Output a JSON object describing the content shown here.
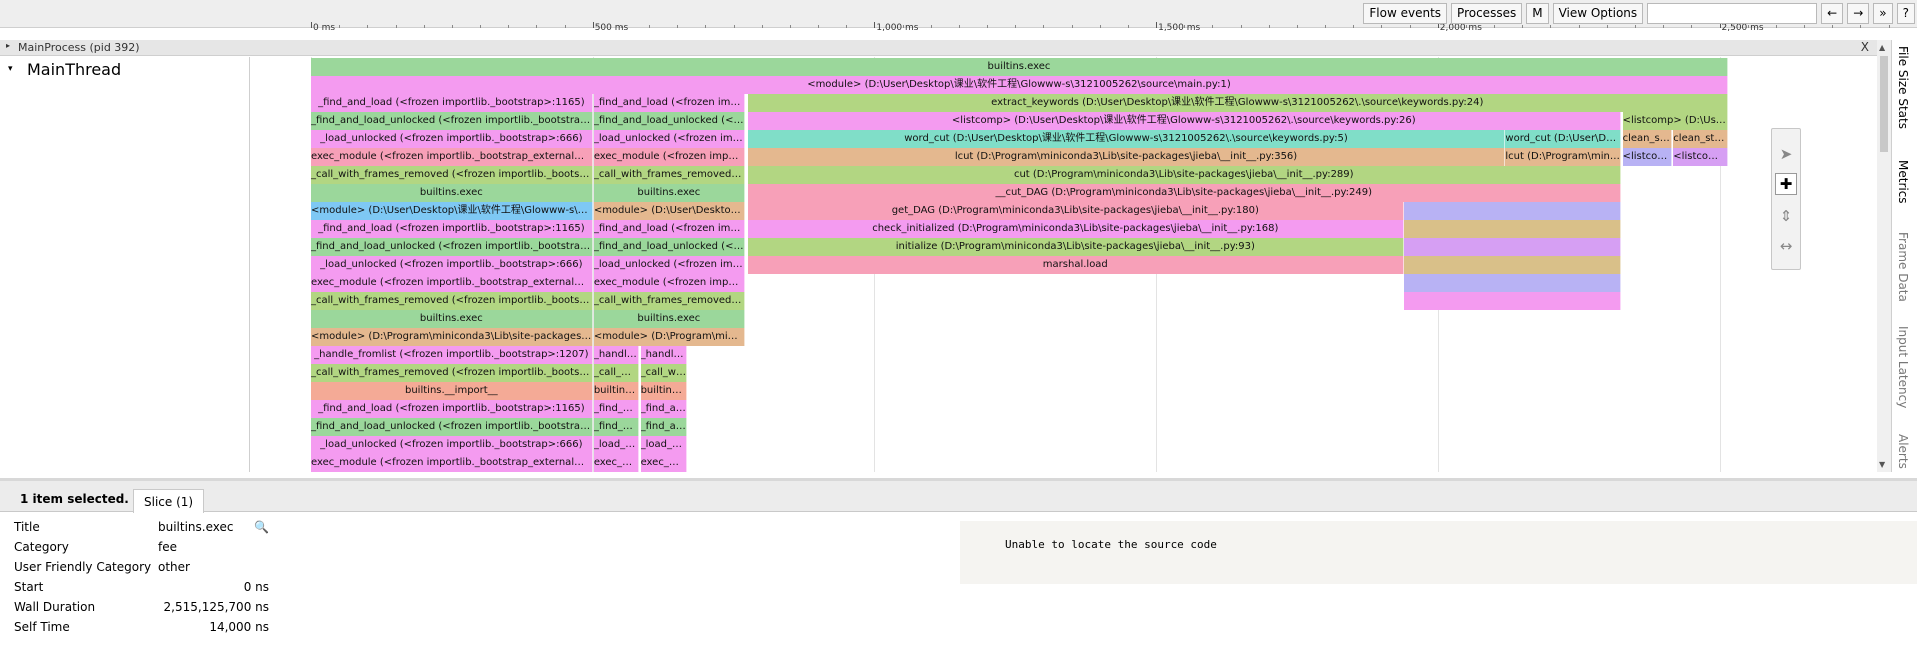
{
  "toolbar": {
    "flow_events": "Flow events",
    "processes": "Processes",
    "m": "M",
    "view_options": "View Options",
    "search_placeholder": "",
    "prev": "←",
    "next": "→",
    "more": "»",
    "help": "?"
  },
  "ruler": {
    "labels": [
      "0 ms",
      "500 ms",
      "1,000 ms",
      "1,500 ms",
      "2,000 ms",
      "2,500 ms"
    ]
  },
  "process": {
    "title": "MainProcess (pid 392)",
    "close": "X",
    "expand_glyph": "▸"
  },
  "thread": {
    "name": "MainThread",
    "expand_glyph": "▾"
  },
  "colors": {
    "green": "#9bd79b",
    "magenta": "#f49bf0",
    "pink": "#f7a0b8",
    "orange": "#e4b88f",
    "salmon": "#f4aa96",
    "cyan": "#80dec8",
    "lime": "#b2d682",
    "lightblue": "#7ec8f4",
    "lavender": "#b8b2f4",
    "tan": "#d9c089",
    "violet": "#d69ff3"
  },
  "slices": [
    {
      "row": 0,
      "start": 0,
      "end": 2515,
      "color": "green",
      "label": "builtins.exec"
    },
    {
      "row": 1,
      "start": 0,
      "end": 2515,
      "color": "magenta",
      "label": "<module> (D:\\User\\Desktop\\课业\\软件工程\\Glowww-s\\3121005262\\source\\main.py:1)"
    },
    {
      "row": 2,
      "start": 0,
      "end": 500,
      "color": "magenta",
      "label": "_find_and_load (<frozen importlib._bootstrap>:1165)"
    },
    {
      "row": 2,
      "start": 502,
      "end": 770,
      "color": "magenta",
      "label": "_find_and_load (<frozen importlib._bootstrap>:1165)"
    },
    {
      "row": 2,
      "start": 775,
      "end": 2515,
      "color": "lime",
      "label": "extract_keywords (D:\\User\\Desktop\\课业\\软件工程\\Glowww-s\\3121005262\\.\\source\\keywords.py:24)"
    },
    {
      "row": 3,
      "start": 0,
      "end": 500,
      "color": "green",
      "label": "_find_and_load_unlocked (<frozen importlib._bootstrap>:1136)"
    },
    {
      "row": 3,
      "start": 502,
      "end": 770,
      "color": "green",
      "label": "_find_and_load_unlocked (<frozen importlib._bootstrap>:1136)"
    },
    {
      "row": 3,
      "start": 775,
      "end": 2325,
      "color": "magenta",
      "label": "<listcomp> (D:\\User\\Desktop\\课业\\软件工程\\Glowww-s\\3121005262\\.\\source\\keywords.py:26)"
    },
    {
      "row": 3,
      "start": 2328,
      "end": 2515,
      "color": "lime",
      "label": "<listcomp> (D:\\User\\Desktop\\课业\\软件工程\\Glowww-s\\3121005262\\.\\source\\keywords.py:30)"
    },
    {
      "row": 4,
      "start": 0,
      "end": 500,
      "color": "magenta",
      "label": "_load_unlocked (<frozen importlib._bootstrap>:666)"
    },
    {
      "row": 4,
      "start": 502,
      "end": 770,
      "color": "magenta",
      "label": "_load_unlocked (<frozen importlib._bootstrap>:666)"
    },
    {
      "row": 4,
      "start": 775,
      "end": 2120,
      "color": "cyan",
      "label": "word_cut (D:\\User\\Desktop\\课业\\软件工程\\Glowww-s\\3121005262\\.\\source\\keywords.py:5)"
    },
    {
      "row": 4,
      "start": 2120,
      "end": 2325,
      "color": "cyan",
      "label": "word_cut (D:\\User\\Desktop\\课业\\软件工程\\Glowww-s\\3121005262\\.\\source\\keywords.py:5)"
    },
    {
      "row": 4,
      "start": 2328,
      "end": 2415,
      "color": "orange",
      "label": "clean_stopwords"
    },
    {
      "row": 4,
      "start": 2418,
      "end": 2515,
      "color": "orange",
      "label": "clean_stopwords"
    },
    {
      "row": 5,
      "start": 0,
      "end": 500,
      "color": "pink",
      "label": "exec_module (<frozen importlib._bootstrap_external>:940)"
    },
    {
      "row": 5,
      "start": 502,
      "end": 770,
      "color": "pink",
      "label": "exec_module (<frozen importlib._bootstrap_external>:940)"
    },
    {
      "row": 5,
      "start": 775,
      "end": 2120,
      "color": "orange",
      "label": "lcut (D:\\Program\\miniconda3\\Lib\\site-packages\\jieba\\__init__.py:356)"
    },
    {
      "row": 5,
      "start": 2120,
      "end": 2325,
      "color": "orange",
      "label": "lcut (D:\\Program\\miniconda3\\Lib\\site-packages\\jieba\\__init__.py:356)"
    },
    {
      "row": 5,
      "start": 2328,
      "end": 2415,
      "color": "lavender",
      "label": "<listcomp>"
    },
    {
      "row": 5,
      "start": 2418,
      "end": 2515,
      "color": "violet",
      "label": "<listcomp>"
    },
    {
      "row": 6,
      "start": 0,
      "end": 500,
      "color": "lime",
      "label": "_call_with_frames_removed (<frozen importlib._bootstrap>:241)"
    },
    {
      "row": 6,
      "start": 502,
      "end": 770,
      "color": "lime",
      "label": "_call_with_frames_removed (<frozen importlib._bootstrap>:241)"
    },
    {
      "row": 6,
      "start": 775,
      "end": 2325,
      "color": "lime",
      "label": "cut (D:\\Program\\miniconda3\\Lib\\site-packages\\jieba\\__init__.py:289)"
    },
    {
      "row": 7,
      "start": 0,
      "end": 500,
      "color": "green",
      "label": "builtins.exec"
    },
    {
      "row": 7,
      "start": 502,
      "end": 770,
      "color": "green",
      "label": "builtins.exec"
    },
    {
      "row": 7,
      "start": 775,
      "end": 2325,
      "color": "pink",
      "label": "__cut_DAG (D:\\Program\\miniconda3\\Lib\\site-packages\\jieba\\__init__.py:249)"
    },
    {
      "row": 8,
      "start": 0,
      "end": 500,
      "color": "lightblue",
      "label": "<module> (D:\\User\\Desktop\\课业\\软件工程\\Glowww-s\\3121005262\\source\\keywords.py:1)"
    },
    {
      "row": 8,
      "start": 502,
      "end": 770,
      "color": "orange",
      "label": "<module> (D:\\User\\Desktop\\课业\\软件工程\\Glowww-s\\3121005262\\source\\similarity.py:1)"
    },
    {
      "row": 8,
      "start": 775,
      "end": 1940,
      "color": "pink",
      "label": "get_DAG (D:\\Program\\miniconda3\\Lib\\site-packages\\jieba\\__init__.py:180)"
    },
    {
      "row": 8,
      "start": 1940,
      "end": 2325,
      "color": "lavender",
      "label": ""
    },
    {
      "row": 9,
      "start": 0,
      "end": 500,
      "color": "magenta",
      "label": "_find_and_load (<frozen importlib._bootstrap>:1165)"
    },
    {
      "row": 9,
      "start": 502,
      "end": 770,
      "color": "magenta",
      "label": "_find_and_load (<frozen importlib._bootstrap>:1165)"
    },
    {
      "row": 9,
      "start": 775,
      "end": 1940,
      "color": "magenta",
      "label": "check_initialized (D:\\Program\\miniconda3\\Lib\\site-packages\\jieba\\__init__.py:168)"
    },
    {
      "row": 9,
      "start": 1940,
      "end": 2325,
      "color": "tan",
      "label": ""
    },
    {
      "row": 10,
      "start": 0,
      "end": 500,
      "color": "green",
      "label": "_find_and_load_unlocked (<frozen importlib._bootstrap>:1136)"
    },
    {
      "row": 10,
      "start": 502,
      "end": 770,
      "color": "green",
      "label": "_find_and_load_unlocked (<frozen importlib._bootstrap>:1136)"
    },
    {
      "row": 10,
      "start": 775,
      "end": 1940,
      "color": "lime",
      "label": "initialize (D:\\Program\\miniconda3\\Lib\\site-packages\\jieba\\__init__.py:93)"
    },
    {
      "row": 10,
      "start": 1940,
      "end": 2325,
      "color": "violet",
      "label": ""
    },
    {
      "row": 11,
      "start": 0,
      "end": 500,
      "color": "magenta",
      "label": "_load_unlocked (<frozen importlib._bootstrap>:666)"
    },
    {
      "row": 11,
      "start": 502,
      "end": 770,
      "color": "magenta",
      "label": "_load_unlocked (<frozen importlib._bootstrap>:666)"
    },
    {
      "row": 11,
      "start": 775,
      "end": 1940,
      "color": "pink",
      "label": "marshal.load"
    },
    {
      "row": 11,
      "start": 1940,
      "end": 2325,
      "color": "tan",
      "label": ""
    },
    {
      "row": 12,
      "start": 0,
      "end": 500,
      "color": "magenta",
      "label": "exec_module (<frozen importlib._bootstrap_external>:940)"
    },
    {
      "row": 12,
      "start": 502,
      "end": 770,
      "color": "magenta",
      "label": "exec_module (<frozen importlib._bootstrap_external>:940)"
    },
    {
      "row": 12,
      "start": 1940,
      "end": 2325,
      "color": "lavender",
      "label": ""
    },
    {
      "row": 13,
      "start": 0,
      "end": 500,
      "color": "lime",
      "label": "_call_with_frames_removed (<frozen importlib._bootstrap>:241)"
    },
    {
      "row": 13,
      "start": 502,
      "end": 770,
      "color": "lime",
      "label": "_call_with_frames_removed (<frozen importlib._bootstrap>:241)"
    },
    {
      "row": 13,
      "start": 1940,
      "end": 2325,
      "color": "magenta",
      "label": ""
    },
    {
      "row": 14,
      "start": 0,
      "end": 500,
      "color": "green",
      "label": "builtins.exec"
    },
    {
      "row": 14,
      "start": 502,
      "end": 770,
      "color": "green",
      "label": "builtins.exec"
    },
    {
      "row": 15,
      "start": 0,
      "end": 500,
      "color": "orange",
      "label": "<module> (D:\\Program\\miniconda3\\Lib\\site-packages\\jieba\\__init__.py:1)"
    },
    {
      "row": 15,
      "start": 502,
      "end": 770,
      "color": "orange",
      "label": "<module> (D:\\Program\\miniconda3\\Lib\\site-packages\\sklearn\\__init__.py:1)"
    },
    {
      "row": 16,
      "start": 0,
      "end": 500,
      "color": "magenta",
      "label": "_handle_fromlist (<frozen importlib._bootstrap>:1207)"
    },
    {
      "row": 16,
      "start": 502,
      "end": 583,
      "color": "magenta",
      "label": "_handle_fromlist"
    },
    {
      "row": 16,
      "start": 585,
      "end": 668,
      "color": "magenta",
      "label": "_handle_fromlist"
    },
    {
      "row": 17,
      "start": 0,
      "end": 500,
      "color": "lime",
      "label": "_call_with_frames_removed (<frozen importlib._bootstrap>:241)"
    },
    {
      "row": 17,
      "start": 502,
      "end": 583,
      "color": "lime",
      "label": "_call_with_frames_removed"
    },
    {
      "row": 17,
      "start": 585,
      "end": 668,
      "color": "lime",
      "label": "_call_with_frames_removed"
    },
    {
      "row": 18,
      "start": 0,
      "end": 500,
      "color": "salmon",
      "label": "builtins.__import__"
    },
    {
      "row": 18,
      "start": 502,
      "end": 583,
      "color": "salmon",
      "label": "builtins.__import__"
    },
    {
      "row": 18,
      "start": 585,
      "end": 668,
      "color": "salmon",
      "label": "builtins.__import__"
    },
    {
      "row": 19,
      "start": 0,
      "end": 500,
      "color": "magenta",
      "label": "_find_and_load (<frozen importlib._bootstrap>:1165)"
    },
    {
      "row": 19,
      "start": 502,
      "end": 583,
      "color": "magenta",
      "label": "_find_and_load"
    },
    {
      "row": 19,
      "start": 585,
      "end": 668,
      "color": "magenta",
      "label": "_find_and_load"
    },
    {
      "row": 20,
      "start": 0,
      "end": 500,
      "color": "green",
      "label": "_find_and_load_unlocked (<frozen importlib._bootstrap>:1136)"
    },
    {
      "row": 20,
      "start": 502,
      "end": 583,
      "color": "green",
      "label": "_find_and_load_unlocked"
    },
    {
      "row": 20,
      "start": 585,
      "end": 668,
      "color": "green",
      "label": "_find_and_load_unlocked"
    },
    {
      "row": 21,
      "start": 0,
      "end": 500,
      "color": "magenta",
      "label": "_load_unlocked (<frozen importlib._bootstrap>:666)"
    },
    {
      "row": 21,
      "start": 502,
      "end": 583,
      "color": "magenta",
      "label": "_load_unlocked"
    },
    {
      "row": 21,
      "start": 585,
      "end": 668,
      "color": "magenta",
      "label": "_load_unlocked"
    },
    {
      "row": 22,
      "start": 0,
      "end": 500,
      "color": "magenta",
      "label": "exec_module (<frozen importlib._bootstrap_external>:940)"
    },
    {
      "row": 22,
      "start": 502,
      "end": 583,
      "color": "magenta",
      "label": "exec_module"
    },
    {
      "row": 22,
      "start": 585,
      "end": 668,
      "color": "magenta",
      "label": "exec_module"
    }
  ],
  "side_tabs": [
    "File Size Stats",
    "Metrics",
    "Frame Data",
    "Input Latency",
    "Alerts"
  ],
  "mouse_mode": {
    "select_icon": "select-arrow-icon",
    "pan_icon": "pan-move-icon",
    "zoom_icon": "zoom-icon",
    "timing_icon": "timing-icon"
  },
  "analysis": {
    "selection_status": "1 item selected.",
    "tab_label": "Slice (1)",
    "props": [
      {
        "key": "Title",
        "value": "builtins.exec"
      },
      {
        "key": "Category",
        "value": "fee"
      },
      {
        "key": "User Friendly Category",
        "value": "other"
      },
      {
        "key": "Start",
        "value": "0 ns"
      },
      {
        "key": "Wall Duration",
        "value": "2,515,125,700 ns"
      },
      {
        "key": "Self Time",
        "value": "14,000 ns"
      }
    ],
    "source_message": "Unable to locate the source code"
  }
}
